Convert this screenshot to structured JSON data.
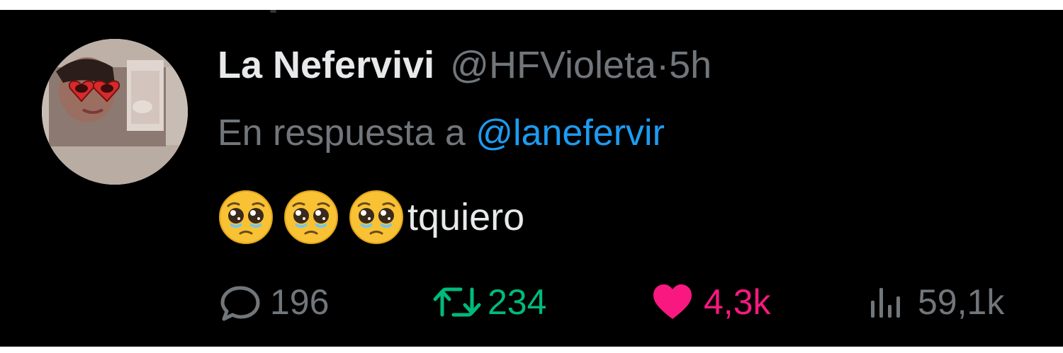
{
  "tweet": {
    "display_name": "La Nefervivi",
    "handle": "@HFVioleta",
    "separator": "·",
    "time": "5h",
    "reply_prefix": "En respuesta a",
    "reply_to": "@lanefervir",
    "text": "tquiero",
    "emoji": "pleading-face-emoji",
    "emoji_count": 3
  },
  "actions": {
    "replies": "196",
    "retweets": "234",
    "likes": "4,3k",
    "views": "59,1k"
  },
  "colors": {
    "background": "#000000",
    "primary_text": "#e7e9ea",
    "secondary_text": "#71767b",
    "mention": "#1d9bf0",
    "retweet": "#00ba7c",
    "like": "#f91880"
  },
  "icons": {
    "reply": "reply-bubble-icon",
    "retweet": "retweet-icon",
    "like": "heart-icon",
    "views": "views-bar-chart-icon"
  }
}
